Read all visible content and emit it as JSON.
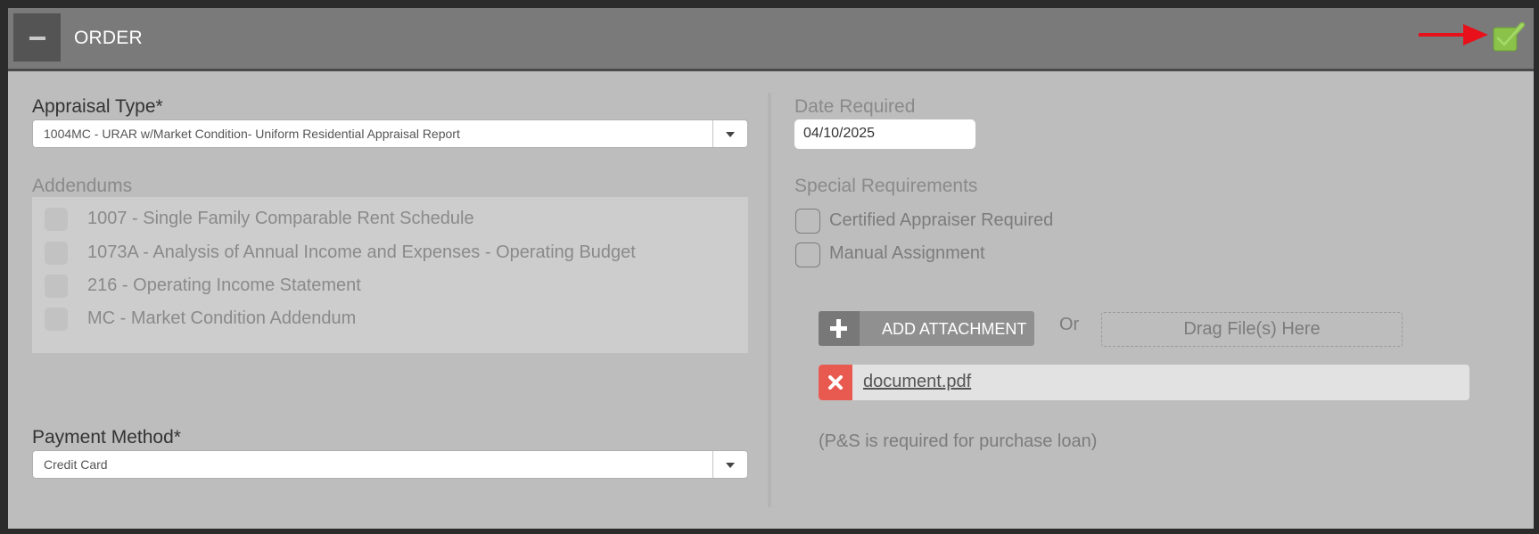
{
  "header": {
    "title": "ORDER"
  },
  "appraisal": {
    "label": "Appraisal Type*",
    "value": "1004MC - URAR w/Market Condition- Uniform Residential Appraisal Report"
  },
  "addendums": {
    "label": "Addendums",
    "items": [
      "1007 - Single Family Comparable Rent Schedule",
      "1073A - Analysis of Annual Income and Expenses - Operating Budget",
      "216 - Operating Income Statement",
      "MC - Market Condition Addendum"
    ]
  },
  "payment": {
    "label": "Payment Method*",
    "value": "Credit Card"
  },
  "date_required": {
    "label": "Date Required",
    "value": "04/10/2025"
  },
  "special": {
    "label": "Special Requirements",
    "items": [
      "Certified Appraiser Required",
      "Manual Assignment"
    ]
  },
  "attachment": {
    "button_label": "ADD ATTACHMENT",
    "or_text": "Or",
    "dropzone_text": "Drag File(s) Here",
    "file_name": "document.pdf",
    "note": "(P&S is required for purchase loan)"
  },
  "colors": {
    "check_green": "#8bc34a",
    "arrow_red": "#e8111b",
    "remove_red": "#e85a4f"
  }
}
